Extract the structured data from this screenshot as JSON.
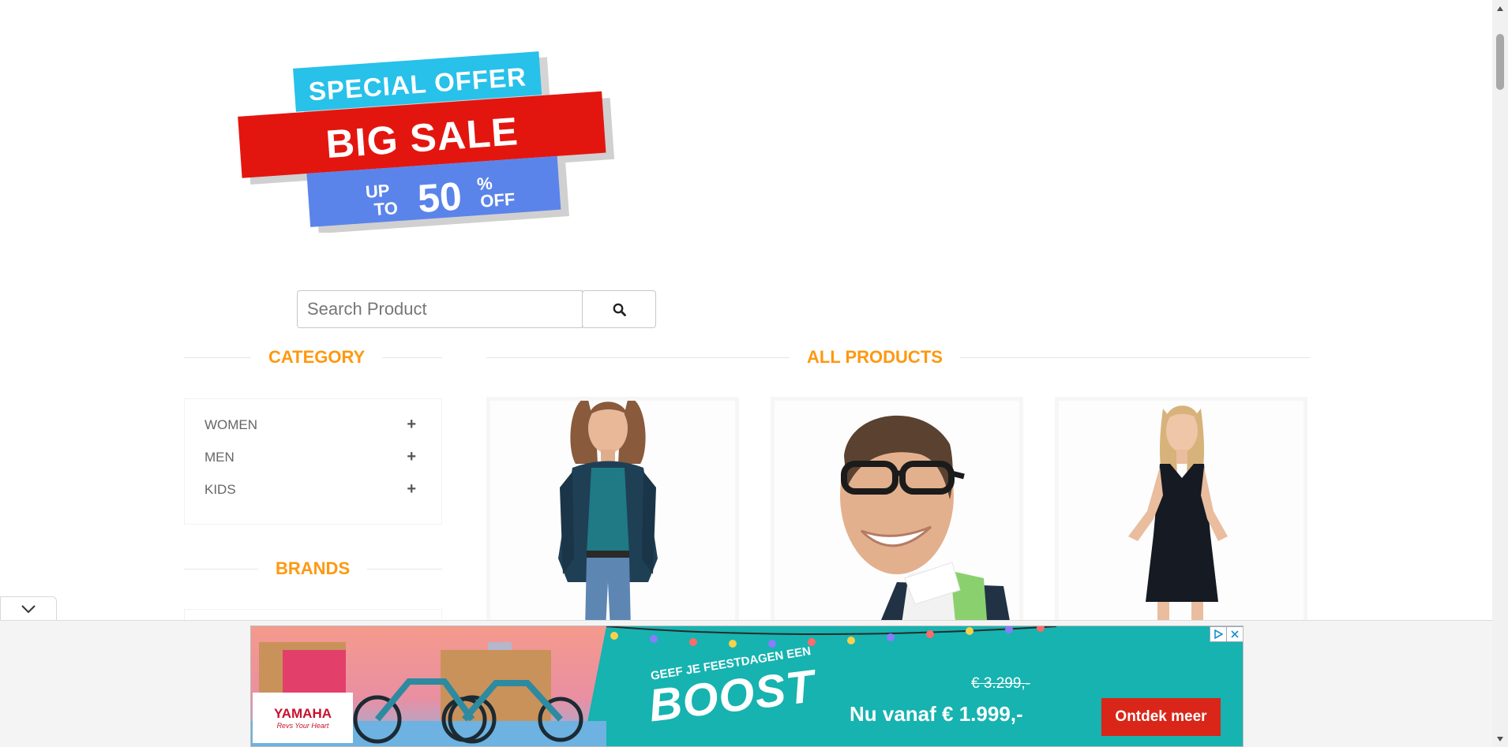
{
  "banner": {
    "line1": "SPECIAL OFFER",
    "line2": "BIG SALE",
    "up": "UP",
    "to": "TO",
    "percent": "50",
    "percent_sign": "%",
    "off": "OFF"
  },
  "search": {
    "placeholder": "Search Product",
    "button_icon": "search-icon"
  },
  "sections": {
    "category_title": "CATEGORY",
    "products_title": "ALL PRODUCTS",
    "brands_title": "BRANDS"
  },
  "categories": [
    {
      "label": "WOMEN",
      "icon": "plus-icon"
    },
    {
      "label": "MEN",
      "icon": "plus-icon"
    },
    {
      "label": "KIDS",
      "icon": "plus-icon"
    }
  ],
  "products": [
    {
      "image": "woman-in-teal-cardigan"
    },
    {
      "image": "smiling-man-with-glasses"
    },
    {
      "image": "woman-in-black-dress"
    }
  ],
  "ad": {
    "logo": "YAMAHA",
    "logo_tagline": "Revs Your Heart",
    "headline_small": "GEEF JE FEESTDAGEN EEN",
    "headline_big": "BOOST",
    "old_price": "€ 3.299,-",
    "new_price": "Nu vanaf € 1.999,-",
    "cta": "Ontdek meer",
    "box_text": "YAMAHA",
    "adchoices_icon": "adchoices-icon",
    "close_icon": "close-icon"
  },
  "colors": {
    "accent": "#fe980f",
    "ad_teal": "#16b3b0",
    "ad_cta": "#d92618"
  }
}
